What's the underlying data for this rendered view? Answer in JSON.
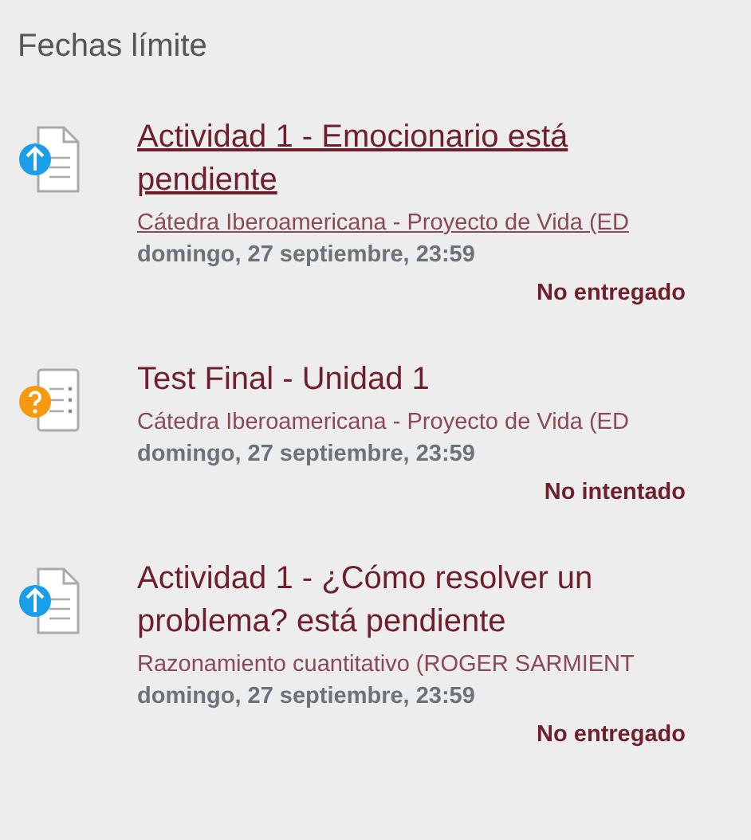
{
  "heading": "Fechas límite",
  "events": [
    {
      "kind": "assignment",
      "title": "Actividad 1 - Emocionario está pendiente",
      "hovered": true,
      "course": "Cátedra Iberoamericana - Proyecto de Vida (ED",
      "date": "domingo, 27 septiembre, 23:59",
      "status": "No entregado"
    },
    {
      "kind": "quiz",
      "title": "Test Final - Unidad 1",
      "hovered": false,
      "course": "Cátedra Iberoamericana - Proyecto de Vida (ED",
      "date": "domingo, 27 septiembre, 23:59",
      "status": "No intentado"
    },
    {
      "kind": "assignment",
      "title": "Actividad 1 - ¿Cómo resolver un problema? está pendiente",
      "hovered": false,
      "course": "Razonamiento cuantitativo (ROGER SARMIENT",
      "date": "domingo, 27 septiembre, 23:59",
      "status": "No entregado"
    }
  ]
}
